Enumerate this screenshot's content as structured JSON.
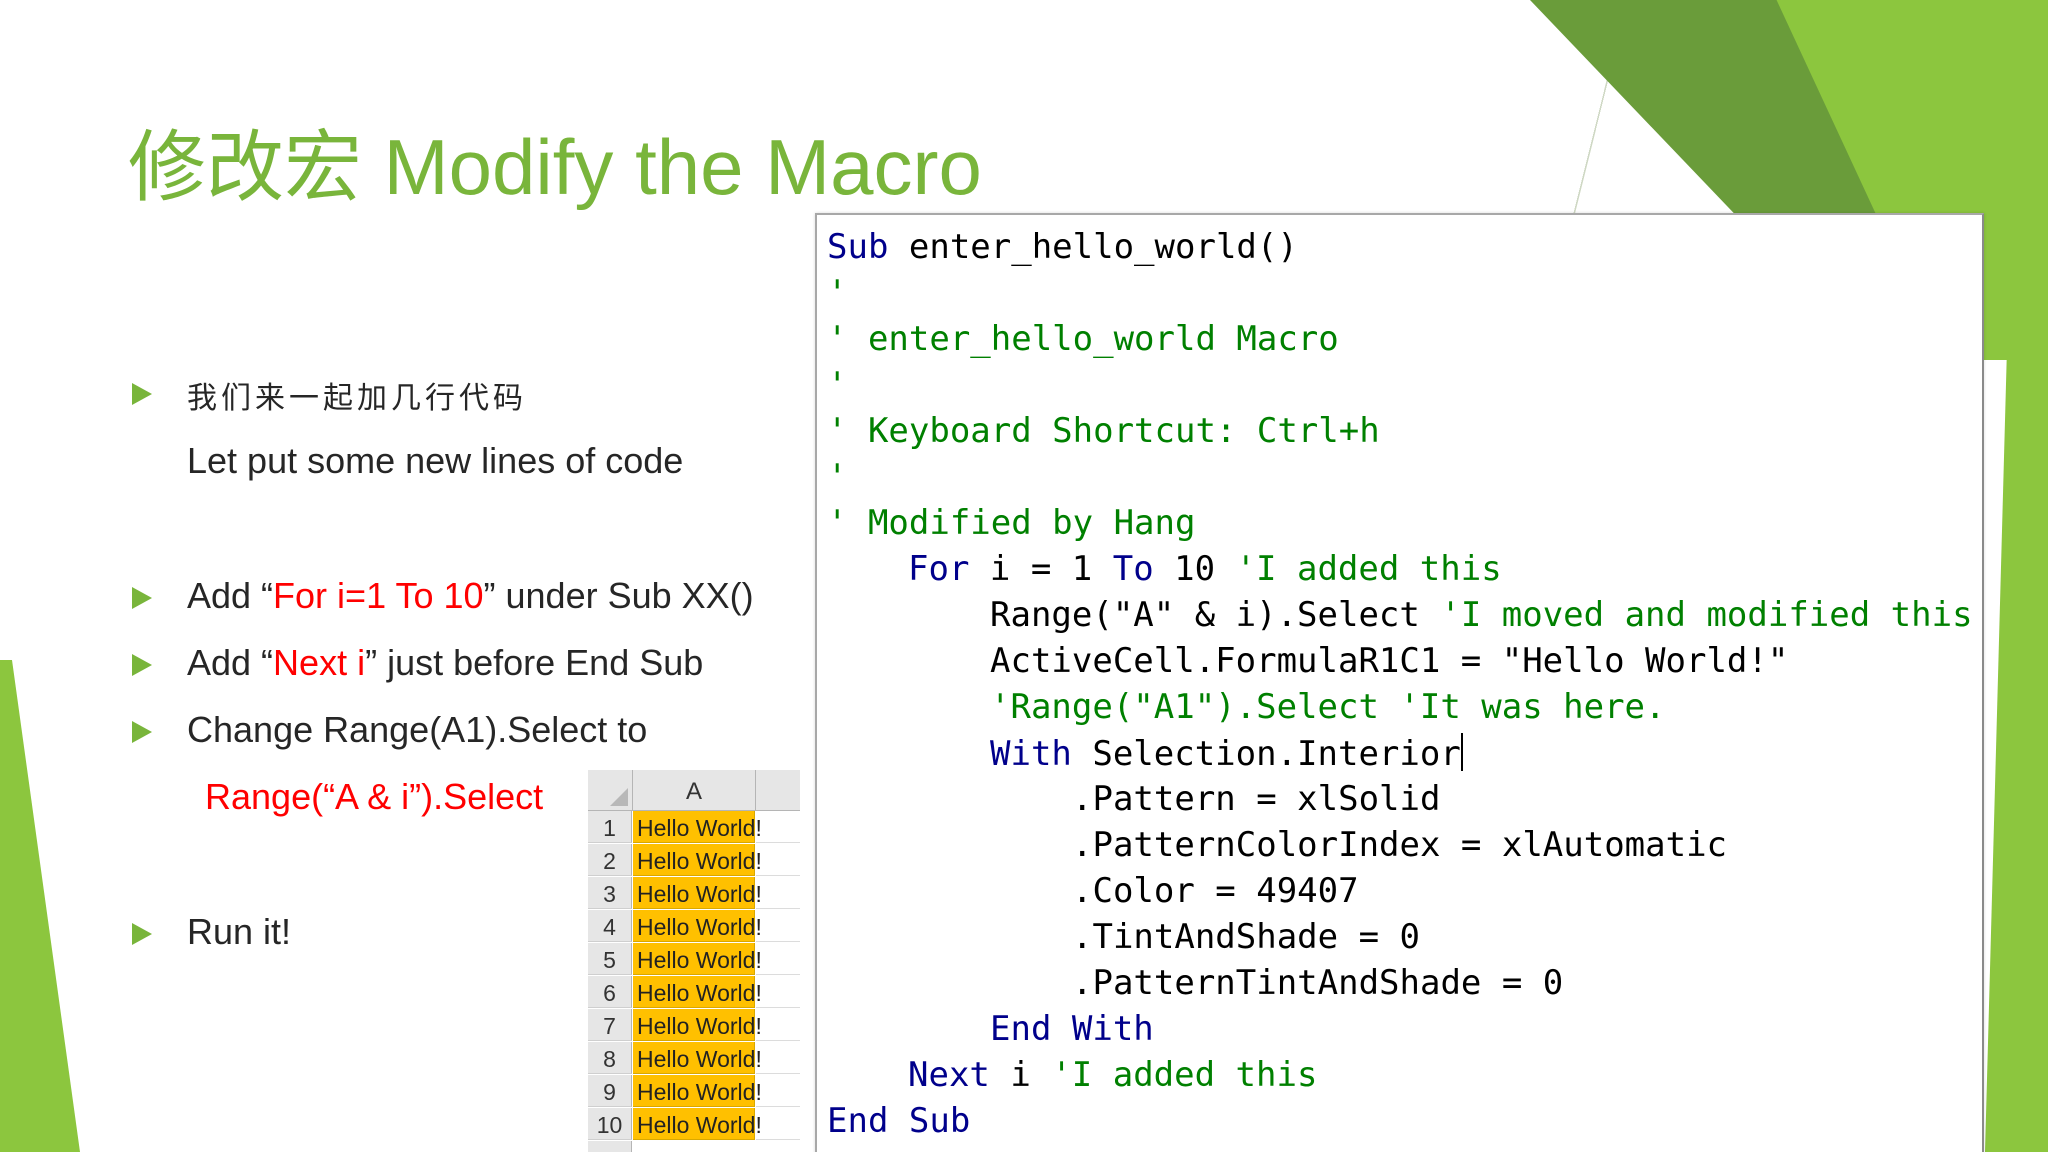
{
  "slide": {
    "title": "修改宏 Modify the Macro",
    "accent_color": "#79b53b",
    "bullets": {
      "b1_cn": "我们来一起加几行代码",
      "b1_en": "Let put some new lines of code",
      "b2_pre": "Add “",
      "b2_red": "For i=1 To 10",
      "b2_post": "” under Sub XX()",
      "b3_pre": "Add “",
      "b3_red": "Next i",
      "b3_post": "” just before End Sub",
      "b4": "Change Range(A1).Select to",
      "b4_red": "Range(“A & i”).Select",
      "b5": "Run it!"
    }
  },
  "code": {
    "l1_kw": "Sub",
    "l1_rest": " enter_hello_world()",
    "l2": "'",
    "l3": "' enter_hello_world Macro",
    "l4": "'",
    "l5": "' Keyboard Shortcut: Ctrl+h",
    "l6": "'",
    "l7": "' Modified by Hang",
    "l8_kw1": "For",
    "l8_mid": " i = 1 ",
    "l8_kw2": "To",
    "l8_num": " 10 ",
    "l8_cm": "'I added this",
    "l9_code": "Range(\"A\" & i).Select ",
    "l9_cm": "'I moved and modified this",
    "l10": "ActiveCell.FormulaR1C1 = \"Hello World!\"",
    "l11": "'Range(\"A1\").Select 'It was here.",
    "l12_kw": "With",
    "l12_rest": " Selection.Interior",
    "l13": ".Pattern = xlSolid",
    "l14": ".PatternColorIndex = xlAutomatic",
    "l15": ".Color = 49407",
    "l16": ".TintAndShade = 0",
    "l17": ".PatternTintAndShade = 0",
    "l18": "End With",
    "l19_kw": "Next",
    "l19_mid": " i ",
    "l19_cm": "'I added this",
    "l20": "End Sub"
  },
  "sheet": {
    "column_label": "A",
    "fill_color": "#ffc000",
    "rows": [
      {
        "n": "1",
        "v": "Hello World!"
      },
      {
        "n": "2",
        "v": "Hello World!"
      },
      {
        "n": "3",
        "v": "Hello World!"
      },
      {
        "n": "4",
        "v": "Hello World!"
      },
      {
        "n": "5",
        "v": "Hello World!"
      },
      {
        "n": "6",
        "v": "Hello World!"
      },
      {
        "n": "7",
        "v": "Hello World!"
      },
      {
        "n": "8",
        "v": "Hello World!"
      },
      {
        "n": "9",
        "v": "Hello World!"
      },
      {
        "n": "10",
        "v": "Hello World!"
      }
    ]
  }
}
